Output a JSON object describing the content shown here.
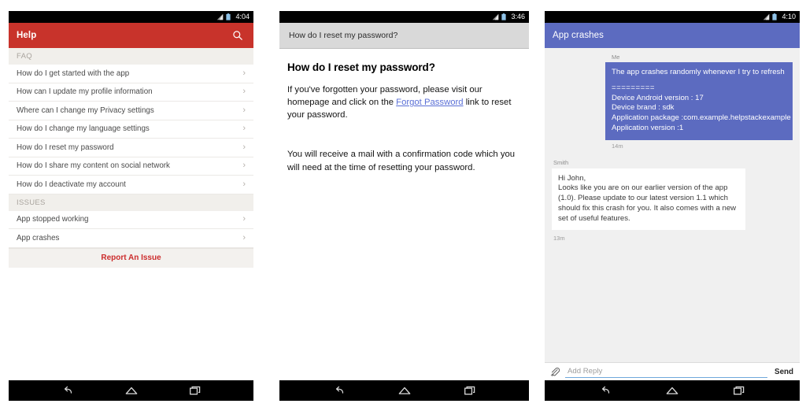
{
  "screens": {
    "help_list": {
      "statusbar": {
        "time": "4:04",
        "signal_icon": "signal-icon",
        "battery_icon": "battery-icon"
      },
      "appbar": {
        "title": "Help",
        "search_icon": "search-icon",
        "color": "#c8332b"
      },
      "sections": [
        {
          "header": "FAQ",
          "items": [
            "How do I get started with the app",
            "How can I update my profile information",
            "Where can I change my Privacy settings",
            "How do I change my language settings",
            "How do I reset my password",
            "How do I share my content on social network",
            "How do I deactivate my account"
          ]
        },
        {
          "header": "ISSUES",
          "items": [
            "App stopped working",
            "App crashes"
          ]
        }
      ],
      "report_button": "Report An Issue",
      "report_color": "#cc2d2d"
    },
    "article": {
      "statusbar": {
        "time": "3:46",
        "signal_icon": "signal-icon",
        "battery_icon": "battery-icon"
      },
      "subbar_title": "How do I reset my password?",
      "heading": "How do I reset my password?",
      "paragraph1_pre": "If you've forgotten your password, please visit our homepage and click on the ",
      "paragraph1_link": "Forgot Password",
      "paragraph1_post": " link to reset your password.",
      "paragraph2": "You will receive a mail with a confirmation code which you will need at the time of resetting your password.",
      "link_color": "#5a6fd6"
    },
    "conversation": {
      "statusbar": {
        "time": "4:10",
        "signal_icon": "signal-icon",
        "battery_icon": "battery-icon"
      },
      "appbar": {
        "title": "App crashes",
        "color": "#5c6bc0"
      },
      "messages": [
        {
          "author": "Me",
          "side": "right",
          "line1": "The app crashes randomly whenever I try to refresh",
          "separator": "=========",
          "detail1": "Device Android version : 17",
          "detail2": "Device brand : sdk",
          "detail3": "Application package :com.example.helpstackexample",
          "detail4": "Application version :1",
          "time": "14m"
        },
        {
          "author": "Smith",
          "side": "left",
          "line1": "Hi John,",
          "line2": "Looks like you are on our earlier version of the app (1.0). Please update to our latest version 1.1 which should fix this crash for you. It also comes with a new set of useful features.",
          "time": "13m"
        }
      ],
      "reply": {
        "attach_icon": "attachment-icon",
        "placeholder": "Add Reply",
        "value": "",
        "send_label": "Send"
      }
    }
  },
  "navbar": {
    "back_icon": "back-icon",
    "home_icon": "home-icon",
    "recents_icon": "recents-icon"
  }
}
